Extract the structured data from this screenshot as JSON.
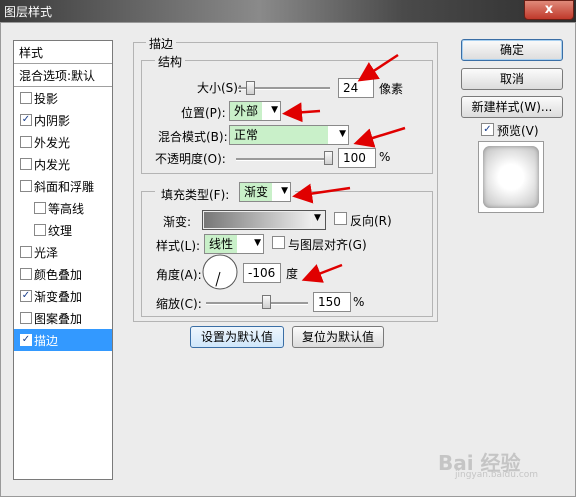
{
  "window": {
    "title": "图层样式",
    "close_symbol": "x"
  },
  "styles_list": {
    "header": "样式",
    "blend_options": "混合选项:默认",
    "items": [
      {
        "label": "投影",
        "checked": false,
        "sub": false,
        "selected": false
      },
      {
        "label": "内阴影",
        "checked": true,
        "sub": false,
        "selected": false
      },
      {
        "label": "外发光",
        "checked": false,
        "sub": false,
        "selected": false
      },
      {
        "label": "内发光",
        "checked": false,
        "sub": false,
        "selected": false
      },
      {
        "label": "斜面和浮雕",
        "checked": false,
        "sub": false,
        "selected": false
      },
      {
        "label": "等高线",
        "checked": false,
        "sub": true,
        "selected": false
      },
      {
        "label": "纹理",
        "checked": false,
        "sub": true,
        "selected": false
      },
      {
        "label": "光泽",
        "checked": false,
        "sub": false,
        "selected": false
      },
      {
        "label": "颜色叠加",
        "checked": false,
        "sub": false,
        "selected": false
      },
      {
        "label": "渐变叠加",
        "checked": true,
        "sub": false,
        "selected": false
      },
      {
        "label": "图案叠加",
        "checked": false,
        "sub": false,
        "selected": false
      },
      {
        "label": "描边",
        "checked": true,
        "sub": false,
        "selected": true
      }
    ],
    "check_mark": "✓"
  },
  "stroke": {
    "group_title": "描边",
    "structure_title": "结构",
    "size_label": "大小(S):",
    "size_value": "24",
    "size_unit": "像素",
    "size_level": 0.1,
    "position_label": "位置(P):",
    "position_value": "外部",
    "blend_mode_label": "混合模式(B):",
    "blend_mode_value": "正常",
    "opacity_label": "不透明度(O):",
    "opacity_value": "100",
    "opacity_unit": "%",
    "opacity_level": 1.0
  },
  "fill": {
    "fill_type_label": "填充类型(F):",
    "fill_type_value": "渐变",
    "gradient_label": "渐变:",
    "reverse_label": "反向(R)",
    "style_label": "样式(L):",
    "style_value": "线性",
    "align_label": "与图层对齐(G)",
    "angle_label": "角度(A):",
    "angle_value": "-106",
    "angle_unit": "度",
    "scale_label": "缩放(C):",
    "scale_value": "150",
    "scale_unit": "%",
    "scale_level": 0.6
  },
  "bottom_buttons": {
    "make_default": "设置为默认值",
    "reset_default": "复位为默认值"
  },
  "right_panel": {
    "ok": "确定",
    "cancel": "取消",
    "new_style": "新建样式(W)...",
    "preview_label": "预览(V)",
    "preview_checked": true
  },
  "watermark": {
    "text": "Bai 经验",
    "sub": "jingyan.baidu.com"
  },
  "colors": {
    "selected": "#3399ff",
    "combo_highlight": "#c9f0c9",
    "arrow": "#e00000"
  }
}
